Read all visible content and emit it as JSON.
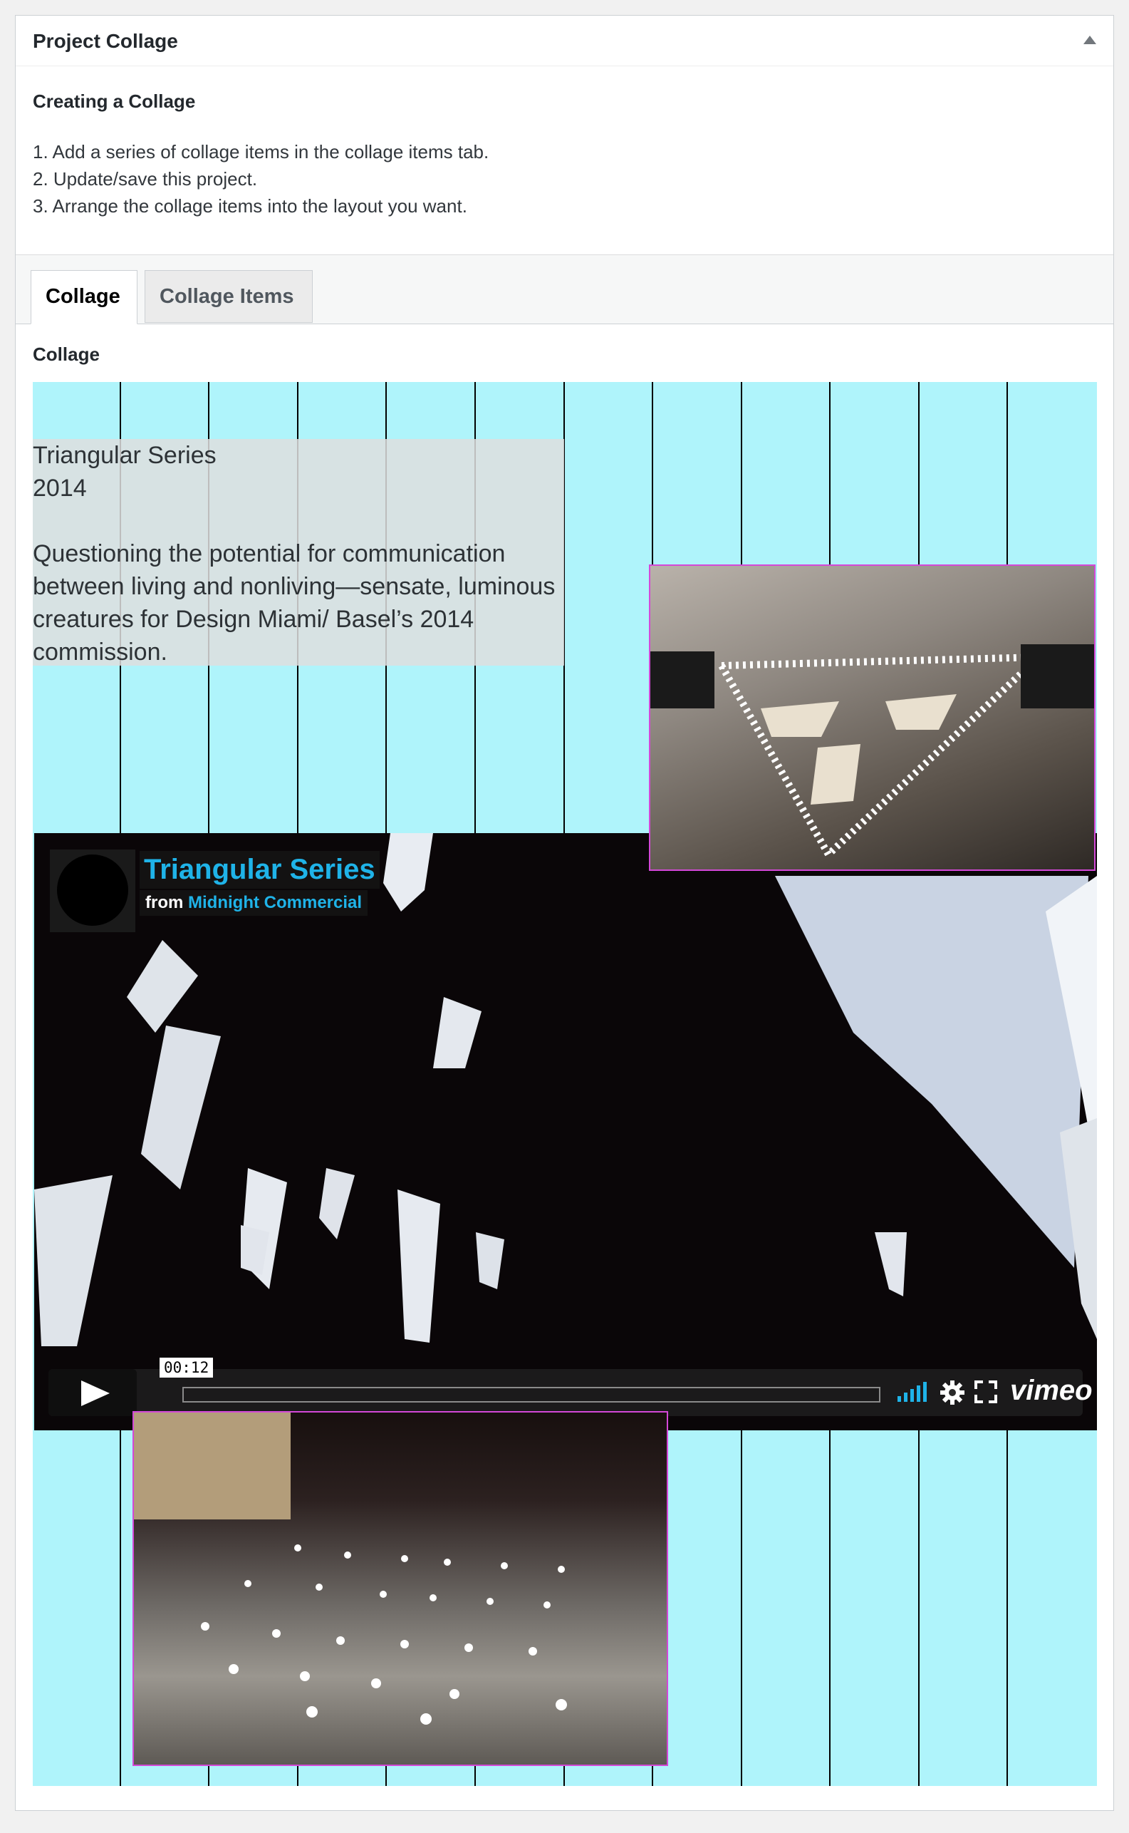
{
  "metabox": {
    "title": "Project Collage",
    "instructions_heading": "Creating a Collage",
    "steps": [
      "1. Add a series of collage items in the collage items tab.",
      "2. Update/save this project.",
      "3. Arrange the collage items into the layout you want."
    ]
  },
  "tabs": {
    "active": "Collage",
    "inactive": "Collage Items"
  },
  "collage": {
    "label": "Collage",
    "text_item": {
      "line1": "Triangular Series",
      "line2": "2014",
      "body": "Questioning the potential for communication between living and nonliving—sensate, luminous creatures for Design Miami/ Basel’s 2014 commission."
    },
    "video": {
      "title": "Triangular Series",
      "from_label": "from",
      "author": "Midnight Commercial",
      "time": "00:12",
      "brand": "vimeo"
    }
  },
  "colors": {
    "grid_bg": "#aff4fb",
    "selection_border": "#d448d8",
    "vimeo_accent": "#1fb3e8"
  }
}
